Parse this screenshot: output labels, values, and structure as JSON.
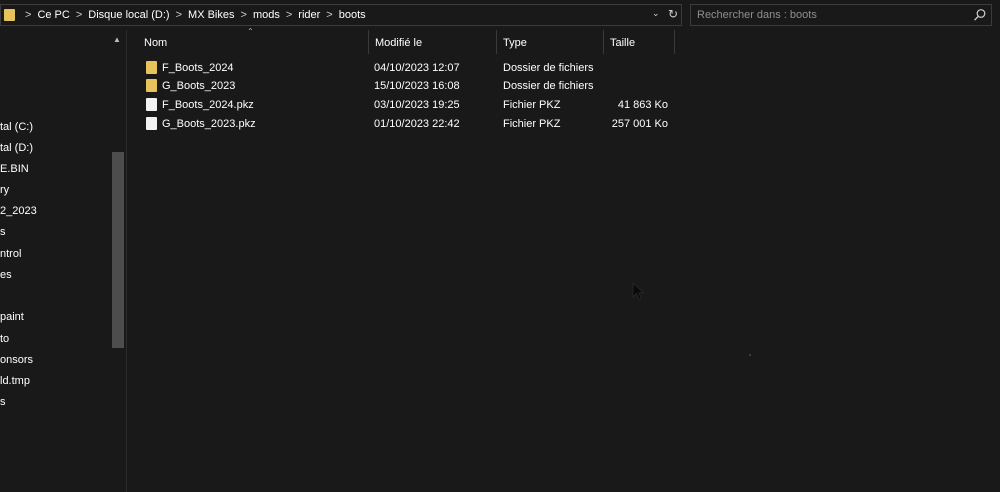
{
  "address_bar": {
    "breadcrumbs": [
      "Ce PC",
      "Disque local (D:)",
      "MX Bikes",
      "mods",
      "rider",
      "boots"
    ],
    "separator": ">",
    "dropdown_icon": "chevron-down-icon",
    "refresh_icon": "refresh-icon"
  },
  "search": {
    "placeholder": "Rechercher dans : boots",
    "value": "",
    "icon": "search-icon"
  },
  "nav_pane": {
    "items": [
      "tal (C:)",
      "tal (D:)",
      "E.BIN",
      "ry",
      "2_2023",
      "s",
      "ntrol",
      "es",
      "paint",
      "to",
      "onsors",
      "ld.tmp",
      "s"
    ]
  },
  "columns": {
    "name": "Nom",
    "modified": "Modifié le",
    "type": "Type",
    "size": "Taille"
  },
  "files": [
    {
      "name": "F_Boots_2024",
      "modified": "04/10/2023 12:07",
      "type": "Dossier de fichiers",
      "size": "",
      "kind": "folder"
    },
    {
      "name": "G_Boots_2023",
      "modified": "15/10/2023 16:08",
      "type": "Dossier de fichiers",
      "size": "",
      "kind": "folder"
    },
    {
      "name": "F_Boots_2024.pkz",
      "modified": "03/10/2023 19:25",
      "type": "Fichier PKZ",
      "size": "41 863 Ko",
      "kind": "file"
    },
    {
      "name": "G_Boots_2023.pkz",
      "modified": "01/10/2023 22:42",
      "type": "Fichier PKZ",
      "size": "257 001 Ko",
      "kind": "file"
    }
  ],
  "colors": {
    "background": "#191919",
    "folder": "#e8c25a",
    "text": "#ffffff",
    "border": "#3c3c3c"
  }
}
